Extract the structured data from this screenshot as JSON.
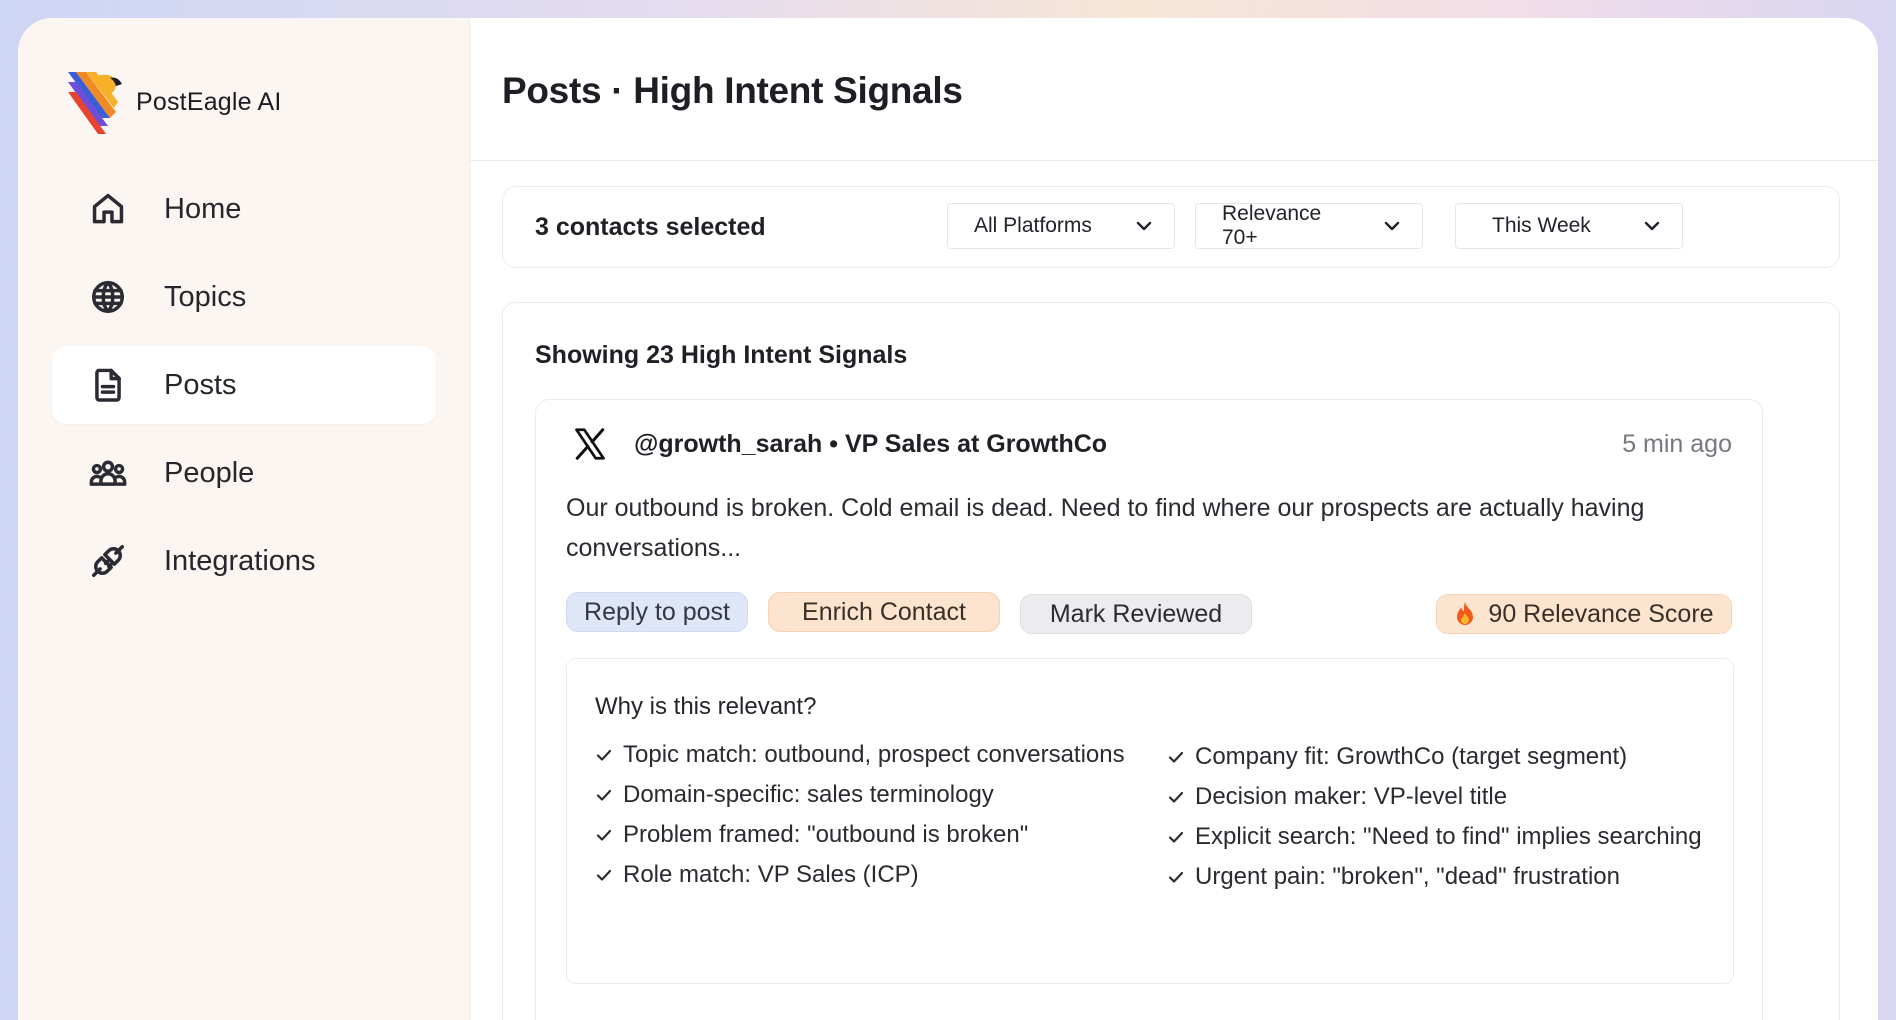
{
  "brand": {
    "name": "PostEagle AI"
  },
  "sidebar": {
    "items": [
      {
        "label": "Home",
        "icon": "home-icon",
        "active": false
      },
      {
        "label": "Topics",
        "icon": "globe-icon",
        "active": false
      },
      {
        "label": "Posts",
        "icon": "document-icon",
        "active": true
      },
      {
        "label": "People",
        "icon": "people-icon",
        "active": false
      },
      {
        "label": "Integrations",
        "icon": "plug-icon",
        "active": false
      }
    ]
  },
  "header": {
    "title": "Posts · High Intent Signals"
  },
  "filters": {
    "selected_text": "3 contacts selected",
    "platform": "All Platforms",
    "relevance": "Relevance 70+",
    "period": "This Week"
  },
  "signals": {
    "heading": "Showing 23 High Intent Signals",
    "post": {
      "platform_icon": "x-logo-icon",
      "author": "@growth_sarah • VP Sales at GrowthCo",
      "time": "5 min ago",
      "text": "Our outbound is broken. Cold email is dead. Need to find where our prospects are actually having conversations...",
      "actions": {
        "reply": "Reply to post",
        "enrich": "Enrich Contact",
        "review": "Mark Reviewed"
      },
      "score_label": "90 Relevance Score",
      "why": {
        "title": "Why is this relevant?",
        "left": [
          "Topic match: outbound, prospect conversations",
          "Domain-specific: sales terminology",
          "Problem framed: \"outbound is broken\"",
          "Role match: VP Sales (ICP)"
        ],
        "right": [
          "Company fit: GrowthCo (target segment)",
          "Decision maker: VP-level title",
          "Explicit search: \"Need to find\" implies searching",
          "Urgent pain: \"broken\", \"dead\" frustration"
        ]
      }
    }
  },
  "colors": {
    "reply_pill": "#dfe6f7",
    "enrich_pill": "#fde4cf",
    "review_pill": "#ececef",
    "sidebar_bg": "#fcf6f2"
  }
}
